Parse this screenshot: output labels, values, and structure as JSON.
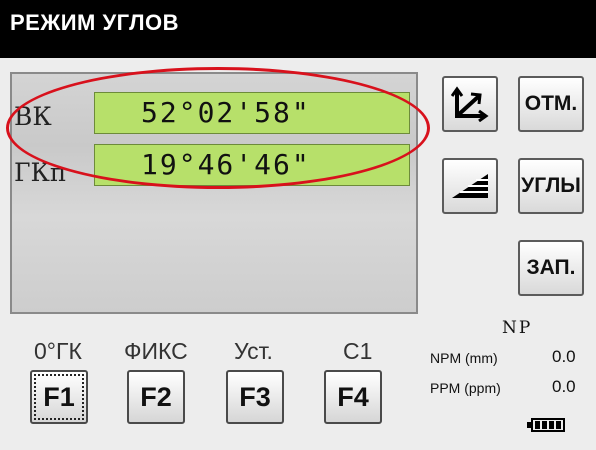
{
  "title": "РЕЖИМ УГЛОВ",
  "rows": [
    {
      "label": "ВК",
      "value": "52°02'58\""
    },
    {
      "label": "ГКп",
      "value": "19°46'46\""
    }
  ],
  "side_buttons": {
    "otm": "ОТМ.",
    "ugly": "УГЛЫ",
    "zap": "ЗАП."
  },
  "function_keys": [
    {
      "label": "0°ГК",
      "key": "F1"
    },
    {
      "label": "ФИКС",
      "key": "F2"
    },
    {
      "label": "Уст.",
      "key": "F3"
    },
    {
      "label": "С1",
      "key": "F4"
    }
  ],
  "status": {
    "mode": "NP",
    "npm_label": "NPM (mm)",
    "npm_value": "0.0",
    "ppm_label": "PPM (ppm)",
    "ppm_value": "0.0"
  },
  "colors": {
    "value_bg": "#b7e06a",
    "highlight": "#d8111c"
  },
  "icons": {
    "coords": "axis-coordinates-icon",
    "slope": "slope-wedge-icon",
    "battery": "battery-icon"
  }
}
